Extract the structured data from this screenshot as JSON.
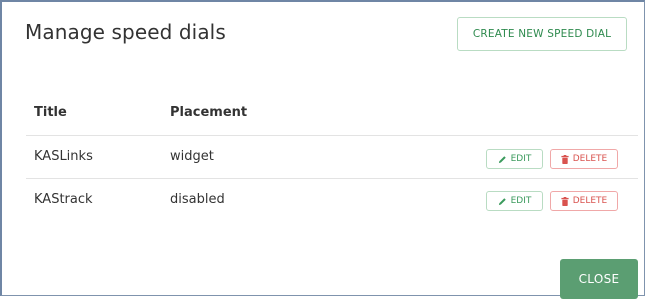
{
  "dialog": {
    "title": "Manage speed dials",
    "create_label": "CREATE NEW SPEED DIAL",
    "close_label": "CLOSE"
  },
  "table": {
    "headers": {
      "title": "Title",
      "placement": "Placement"
    },
    "rows": [
      {
        "title": "KASLinks",
        "placement": "widget",
        "edit_label": "EDIT",
        "delete_label": "DELETE"
      },
      {
        "title": "KAStrack",
        "placement": "disabled",
        "edit_label": "EDIT",
        "delete_label": "DELETE"
      }
    ]
  },
  "colors": {
    "accent_green": "#5b9e72",
    "danger_red": "#d9534f"
  },
  "icons": {
    "edit": "pencil-icon",
    "delete": "trash-icon"
  }
}
